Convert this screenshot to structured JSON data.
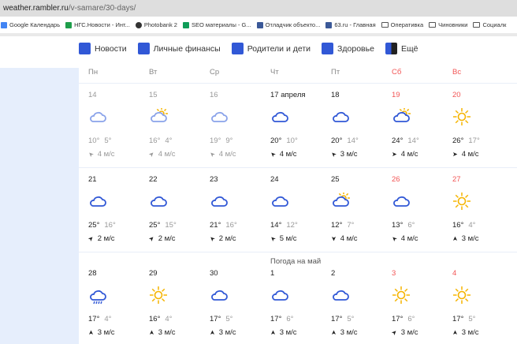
{
  "browser": {
    "domain": "weather.rambler.ru",
    "path": "/v-samare/30-days/"
  },
  "bookmarks": [
    {
      "label": "Google Календарь",
      "icon": "calendar-icon",
      "color": "#4285f4"
    },
    {
      "label": "НГС.Новости - Инт...",
      "icon": "sheet-icon",
      "color": "#1e9e4a"
    },
    {
      "label": "Photobank 2",
      "icon": "globe-icon",
      "color": "#333333"
    },
    {
      "label": "SEO материалы - G...",
      "icon": "sheet-icon",
      "color": "#0f9d58"
    },
    {
      "label": "Отладчик объекто...",
      "icon": "facebook-icon",
      "color": "#3b5998"
    },
    {
      "label": "63.ru - Главная",
      "icon": "facebook-icon",
      "color": "#3b5998"
    },
    {
      "label": "Оперативка",
      "icon": "folder-icon"
    },
    {
      "label": "Чиновники",
      "icon": "folder-icon"
    },
    {
      "label": "Социалк",
      "icon": "folder-icon"
    }
  ],
  "nav": [
    {
      "label": "Новости"
    },
    {
      "label": "Личные финансы"
    },
    {
      "label": "Родители и дети"
    },
    {
      "label": "Здоровье"
    },
    {
      "label": "Ещё"
    }
  ],
  "colors": {
    "accent": "#3158d6",
    "weekend": "#f25555",
    "sun": "#f5b400",
    "past": "#999999"
  },
  "weekdays": [
    {
      "label": "Пн"
    },
    {
      "label": "Вт"
    },
    {
      "label": "Ср"
    },
    {
      "label": "Чт"
    },
    {
      "label": "Пт"
    },
    {
      "label": "Сб",
      "weekend": true
    },
    {
      "label": "Вс",
      "weekend": true
    }
  ],
  "month_label": "Погода на май",
  "weeks": [
    [
      {
        "date": "14",
        "icon": "cloud",
        "hi": "10°",
        "lo": "5°",
        "wind": "4 м/с",
        "dir": 225,
        "past": true
      },
      {
        "date": "15",
        "icon": "partly-sunny",
        "hi": "16°",
        "lo": "4°",
        "wind": "4 м/с",
        "dir": -45,
        "past": true
      },
      {
        "date": "16",
        "icon": "cloud",
        "hi": "19°",
        "lo": "9°",
        "wind": "4 м/с",
        "dir": 225,
        "past": true
      },
      {
        "date": "17 апреля",
        "icon": "cloud",
        "hi": "20°",
        "lo": "10°",
        "wind": "4 м/с",
        "dir": 225
      },
      {
        "date": "18",
        "icon": "cloud",
        "hi": "20°",
        "lo": "14°",
        "wind": "3 м/с",
        "dir": 225
      },
      {
        "date": "19",
        "icon": "partly-sunny",
        "hi": "24°",
        "lo": "14°",
        "wind": "4 м/с",
        "dir": 0,
        "weekend": true
      },
      {
        "date": "20",
        "icon": "sun",
        "hi": "26°",
        "lo": "17°",
        "wind": "4 м/с",
        "dir": 0,
        "weekend": true
      }
    ],
    [
      {
        "date": "21",
        "icon": "cloud",
        "hi": "25°",
        "lo": "16°",
        "wind": "2 м/с",
        "dir": -45
      },
      {
        "date": "22",
        "icon": "cloud",
        "hi": "25°",
        "lo": "15°",
        "wind": "2 м/с",
        "dir": -45
      },
      {
        "date": "23",
        "icon": "cloud",
        "hi": "21°",
        "lo": "16°",
        "wind": "2 м/с",
        "dir": 225
      },
      {
        "date": "24",
        "icon": "cloud",
        "hi": "14°",
        "lo": "12°",
        "wind": "5 м/с",
        "dir": 225
      },
      {
        "date": "25",
        "icon": "partly-sunny",
        "hi": "12°",
        "lo": "7°",
        "wind": "4 м/с",
        "dir": 90
      },
      {
        "date": "26",
        "icon": "cloud",
        "hi": "13°",
        "lo": "6°",
        "wind": "4 м/с",
        "dir": 225,
        "weekend": true
      },
      {
        "date": "27",
        "icon": "sun",
        "hi": "16°",
        "lo": "4°",
        "wind": "3 м/с",
        "dir": -90,
        "weekend": true
      }
    ],
    [
      {
        "date": "28",
        "icon": "rain",
        "hi": "17°",
        "lo": "4°",
        "wind": "3 м/с",
        "dir": -90
      },
      {
        "date": "29",
        "icon": "sun",
        "hi": "16°",
        "lo": "4°",
        "wind": "3 м/с",
        "dir": -90
      },
      {
        "date": "30",
        "icon": "cloud",
        "hi": "17°",
        "lo": "5°",
        "wind": "3 м/с",
        "dir": -90
      },
      {
        "date": "1",
        "icon": "cloud",
        "hi": "17°",
        "lo": "6°",
        "wind": "3 м/с",
        "dir": -90
      },
      {
        "date": "2",
        "icon": "cloud",
        "hi": "17°",
        "lo": "5°",
        "wind": "3 м/с",
        "dir": -90
      },
      {
        "date": "3",
        "icon": "sun",
        "hi": "17°",
        "lo": "6°",
        "wind": "3 м/с",
        "dir": -45,
        "weekend": true
      },
      {
        "date": "4",
        "icon": "sun",
        "hi": "17°",
        "lo": "5°",
        "wind": "3 м/с",
        "dir": -90,
        "weekend": true
      }
    ]
  ]
}
